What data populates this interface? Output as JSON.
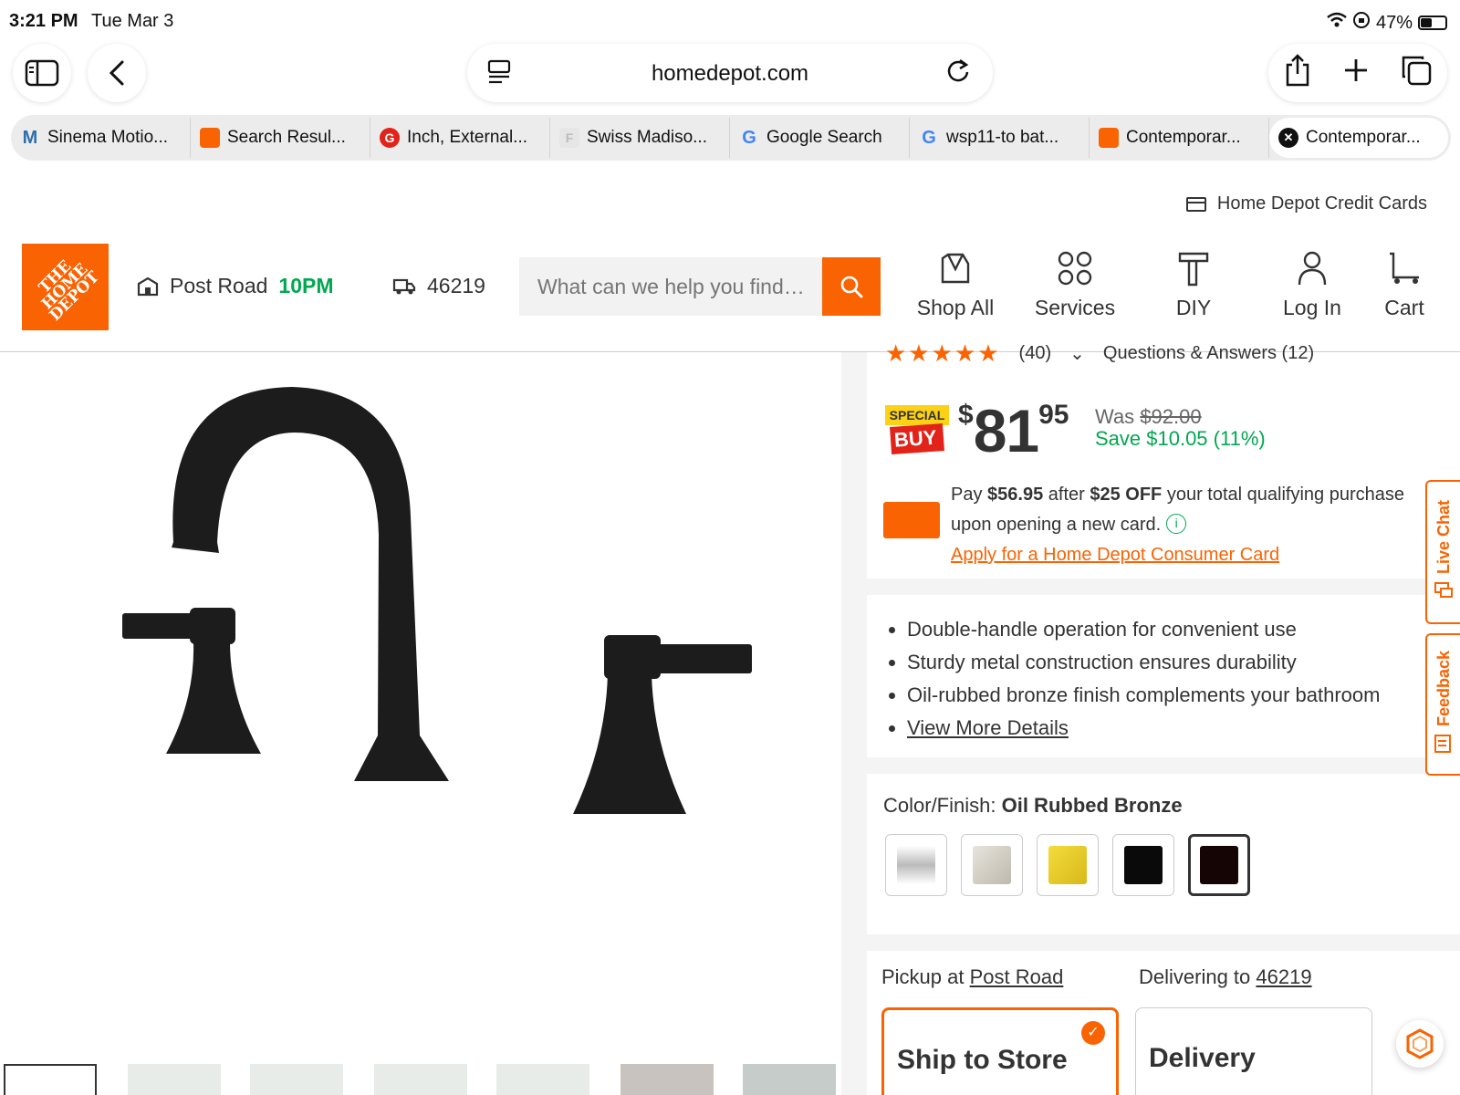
{
  "status_bar": {
    "time": "3:21 PM",
    "date": "Tue Mar 3",
    "battery": "47%"
  },
  "browser": {
    "url": "homedepot.com",
    "tabs": [
      {
        "label": "Sinema Motio...",
        "favicon": "M",
        "favicon_color": "#2f6fa8"
      },
      {
        "label": "Search Resul...",
        "favicon": "HD",
        "favicon_color": "#f96302"
      },
      {
        "label": "Inch, External...",
        "favicon": "G",
        "favicon_color": "#e2231a"
      },
      {
        "label": "Swiss Madiso...",
        "favicon": "F",
        "favicon_color": "#bbbbbb"
      },
      {
        "label": "Google Search",
        "favicon": "G",
        "favicon_color": "#4285f4"
      },
      {
        "label": "wsp11-to bat...",
        "favicon": "G",
        "favicon_color": "#4285f4"
      },
      {
        "label": "Contemporar...",
        "favicon": "HD",
        "favicon_color": "#f96302"
      },
      {
        "label": "Contemporar...",
        "favicon": "close-icon",
        "favicon_color": "#111111"
      }
    ]
  },
  "header": {
    "credit_link": "Home Depot Credit Cards",
    "logo_text": "THE HOME DEPOT",
    "store_name": "Post Road",
    "store_hours": "10PM",
    "zip": "46219",
    "search_placeholder": "What can we help you find…",
    "nav": {
      "shop_all": "Shop All",
      "services": "Services",
      "diy": "DIY",
      "login": "Log In",
      "cart": "Cart"
    }
  },
  "product": {
    "rating_count": "(40)",
    "qa_label": "Questions & Answers (12)",
    "badge_top": "SPECIAL",
    "badge_bottom": "BUY",
    "price_currency": "$",
    "price_dollars": "81",
    "price_cents": "95",
    "was_label": "Was",
    "was_price": "$92.00",
    "save_text": "Save $10.05 (11%)",
    "promo": {
      "pay_word": "Pay",
      "pay_amount": "$56.95",
      "after_word": "after",
      "off_amount": "$25 OFF",
      "rest_line1": "your total qualifying purchase",
      "line2": "upon opening a new card.",
      "apply_link": "Apply for a Home Depot Consumer Card"
    },
    "bullets": [
      "Double-handle operation for convenient use",
      "Sturdy metal construction ensures durability",
      "Oil-rubbed bronze finish complements your bathroom"
    ],
    "view_more": "View More Details",
    "color_label": "Color/Finish:",
    "color_value": "Oil Rubbed Bronze",
    "swatch_colors": [
      "#d9d9d9",
      "#d2cfc6",
      "#e8c927",
      "#0a0a0a",
      "#150505"
    ],
    "pickup_label": "Pickup at",
    "pickup_store": "Post Road",
    "delivery_label": "Delivering to",
    "delivery_zip": "46219",
    "ship_to_store": "Ship to Store",
    "delivery_tile": "Delivery"
  },
  "side_tabs": {
    "live_chat": "Live Chat",
    "feedback": "Feedback"
  },
  "colors": {
    "brand_orange": "#f96302",
    "green": "#00a84f"
  }
}
